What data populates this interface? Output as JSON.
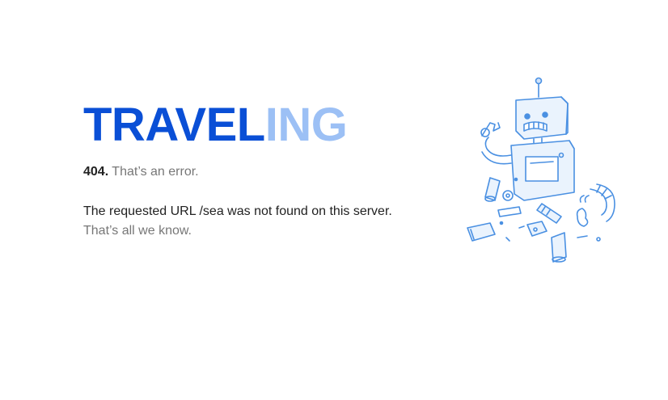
{
  "logo": {
    "part1": "TRAVEL",
    "part2": "ING",
    "colors": {
      "dark": "#0a4fd6",
      "light": "#9cc0f5"
    }
  },
  "error": {
    "code": "404.",
    "summary": "That’s an error.",
    "message": "The requested URL /sea was not found on this server.",
    "footnote": "That’s all we know."
  },
  "illustration": {
    "icon": "broken-robot-illustration",
    "color": "#4a90e2"
  }
}
